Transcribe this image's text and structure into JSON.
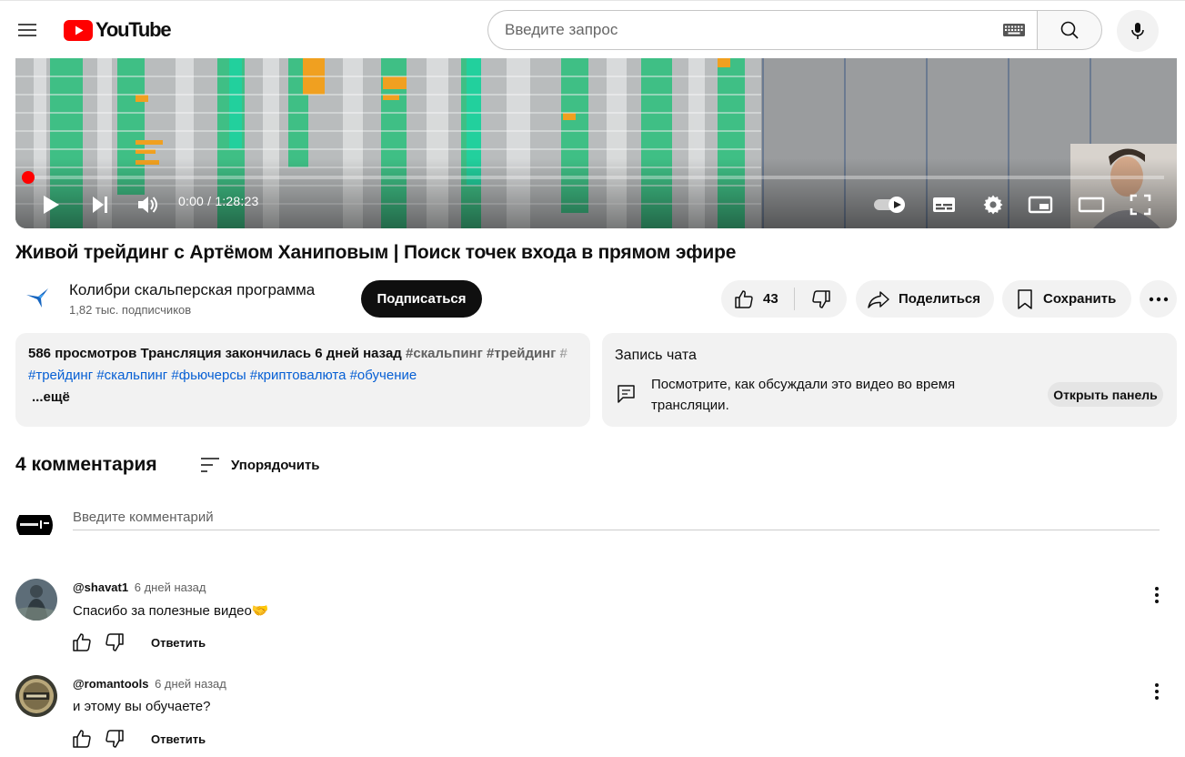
{
  "header": {
    "logo_text": "YouTube",
    "search_placeholder": "Введите запрос"
  },
  "player": {
    "time_display": "0:00 / 1:28:23",
    "progress": 0
  },
  "video": {
    "title": "Живой трейдинг с Артёмом Ханиповым | Поиск точек входа в прямом эфире",
    "channel_name": "Колибри скальперская программа",
    "subscribers": "1,82 тыс. подписчиков",
    "subscribe_label": "Подписаться",
    "like_count": "43",
    "share_label": "Поделиться",
    "save_label": "Сохранить"
  },
  "description": {
    "meta": "586 просмотров  Трансляция закончилась 6 дней назад",
    "top_tags": "#скальпинг #трейдинг #",
    "tags": "#трейдинг #скальпинг #фьючерсы #криптовалюта #обучение",
    "more_label": "...ещё"
  },
  "chat": {
    "title": "Запись чата",
    "text": "Посмотрите, как обсуждали это видео во время трансляции.",
    "button_label": "Открыть панель"
  },
  "comments": {
    "count_label": "4 комментария",
    "sort_label": "Упорядочить",
    "input_placeholder": "Введите комментарий",
    "reply_label": "Ответить",
    "items": [
      {
        "author": "@shavat1",
        "time": "6 дней назад",
        "text": "Спасибо за полезные видео🤝"
      },
      {
        "author": "@romantools",
        "time": "6 дней назад",
        "text": "и этому вы обучаете?"
      }
    ]
  },
  "colors": {
    "brand_red": "#ff0000",
    "link_blue": "#065fd4",
    "chip_bg": "#f2f2f2"
  }
}
